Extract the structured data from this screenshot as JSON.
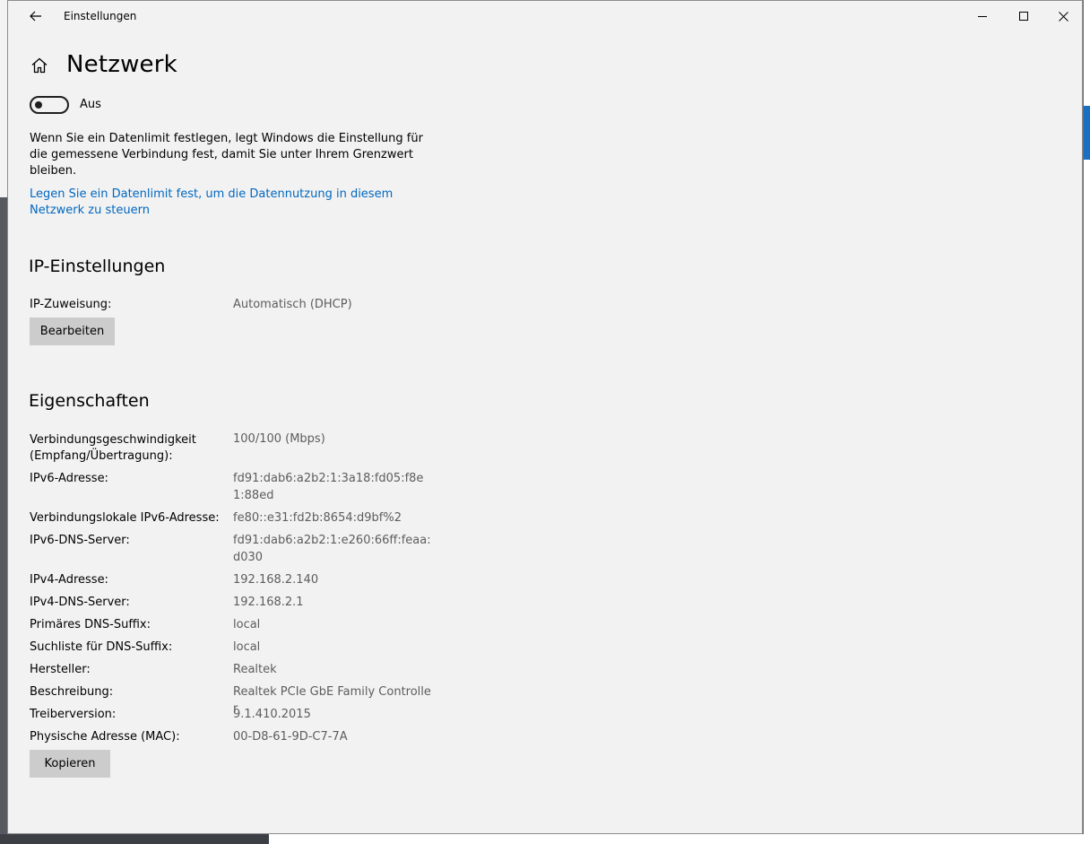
{
  "window": {
    "title": "Einstellungen"
  },
  "page": {
    "title": "Netzwerk"
  },
  "metered": {
    "toggle_label": "Aus",
    "description": "Wenn Sie ein Datenlimit festlegen, legt Windows die Einstellung für die gemessene Verbindung fest, damit Sie unter Ihrem Grenzwert bleiben.",
    "link": "Legen Sie ein Datenlimit fest, um die Datennutzung in diesem Netzwerk zu steuern"
  },
  "ip_settings": {
    "heading": "IP-Einstellungen",
    "assignment_label": "IP-Zuweisung:",
    "assignment_value": "Automatisch (DHCP)",
    "edit_button": "Bearbeiten"
  },
  "properties": {
    "heading": "Eigenschaften",
    "rows": [
      {
        "label": "Verbindungsgeschwindigkeit (Empfang/Übertragung):",
        "value": "100/100 (Mbps)"
      },
      {
        "label": "IPv6-Adresse:",
        "value": "fd91:dab6:a2b2:1:3a18:fd05:f8e1:88ed"
      },
      {
        "label": "Verbindungslokale IPv6-Adresse:",
        "value": "fe80::e31:fd2b:8654:d9bf%2"
      },
      {
        "label": "IPv6-DNS-Server:",
        "value": "fd91:dab6:a2b2:1:e260:66ff:feaa:d030"
      },
      {
        "label": "IPv4-Adresse:",
        "value": "192.168.2.140"
      },
      {
        "label": "IPv4-DNS-Server:",
        "value": "192.168.2.1"
      },
      {
        "label": "Primäres DNS-Suffix:",
        "value": "local"
      },
      {
        "label": "Suchliste für DNS-Suffix:",
        "value": "local"
      },
      {
        "label": "Hersteller:",
        "value": "Realtek"
      },
      {
        "label": "Beschreibung:",
        "value": "Realtek PCIe GbE Family Controller"
      },
      {
        "label": "Treiberversion:",
        "value": "9.1.410.2015"
      },
      {
        "label": "Physische Adresse (MAC):",
        "value": "00-D8-61-9D-C7-7A"
      }
    ],
    "copy_button": "Kopieren"
  },
  "colors": {
    "link": "#0067c0",
    "window_bg": "#f2f2f2",
    "button_bg": "#cccccc",
    "value_text": "#5d5d5d"
  }
}
